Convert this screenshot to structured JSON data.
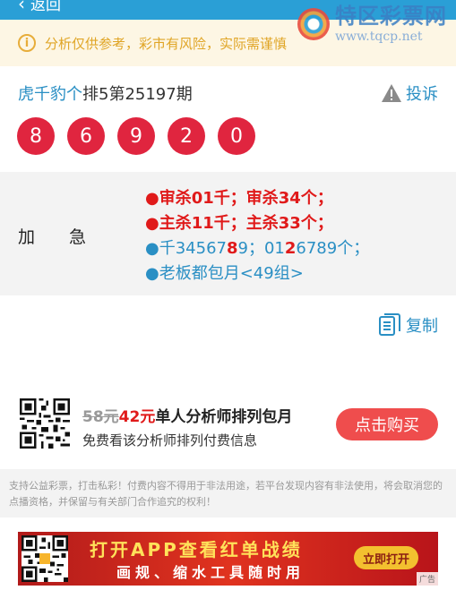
{
  "topbar": {
    "back_label": "返回"
  },
  "watermark": {
    "title": "特区彩票网",
    "url": "www.tqcp.net"
  },
  "notice": {
    "text": "分析仅供参考，彩市有风险，实际需谨慎"
  },
  "header": {
    "author": "虎千豹个",
    "title_suffix": "排5第25197期",
    "report_label": "投诉"
  },
  "balls": [
    "8",
    "6",
    "9",
    "2",
    "0"
  ],
  "panel": {
    "label_a": "加",
    "label_b": "急",
    "line1": {
      "dot": "●",
      "text": "审杀01千；审杀34个",
      "end": "；"
    },
    "line2": {
      "dot": "●",
      "text": "主杀11千；主杀33个",
      "end": "；"
    },
    "line3": {
      "dot": "●",
      "p1": "千34567",
      "p2": "8",
      "p3": "9；01",
      "p4": "2",
      "p5": "6789个；"
    },
    "line4": {
      "dot": "●",
      "text": "老板都包月<49组>"
    }
  },
  "copy_label": "复制",
  "promo": {
    "old_price": "58元",
    "new_price": "42元",
    "title": "单人分析师排列包月",
    "subtitle": "免费看该分析师排列付费信息",
    "buy_label": "点击购买"
  },
  "footer_note": "支持公益彩票，打击私彩！付费内容不得用于非法用途，若平台发现内容有非法使用，将会取消您的点播资格，并保留与有关部门合作追究的权利！",
  "ad": {
    "title": "打开APP查看红单战绩",
    "subtitle": "画规、缩水工具随时用",
    "button": "立即打开",
    "tag": "广告"
  },
  "colors": {
    "accent_blue": "#2a8fc4",
    "ball_red": "#e0253f",
    "notice_bg": "#fdf6e4",
    "buy_red": "#ef4d4d"
  }
}
